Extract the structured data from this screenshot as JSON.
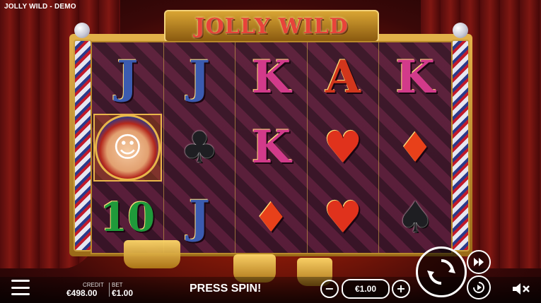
{
  "window": {
    "title": "JOLLY WILD - DEMO"
  },
  "game": {
    "logo_text": "JOLLY WILD"
  },
  "reels": [
    [
      "J",
      "J",
      "K",
      "A",
      "K"
    ],
    [
      "JOKER",
      "♣",
      "K",
      "♥",
      "♦"
    ],
    [
      "10",
      "J",
      "♦",
      "♥",
      "♠"
    ]
  ],
  "footer": {
    "credit_label": "CREDIT",
    "credit_value": "€498.00",
    "bet_label": "BET",
    "bet_value": "€1.00",
    "status": "PRESS SPIN!",
    "bet_selector_value": "€1.00",
    "minus_label": "−",
    "plus_label": "+"
  },
  "icons": [
    "menu-icon",
    "spin-icon",
    "turbo-icon",
    "autoplay-icon",
    "mute-icon"
  ],
  "colors": {
    "accent": "#e8433a",
    "gold": "#d9a534",
    "reel_bg": "#3a0d34"
  }
}
